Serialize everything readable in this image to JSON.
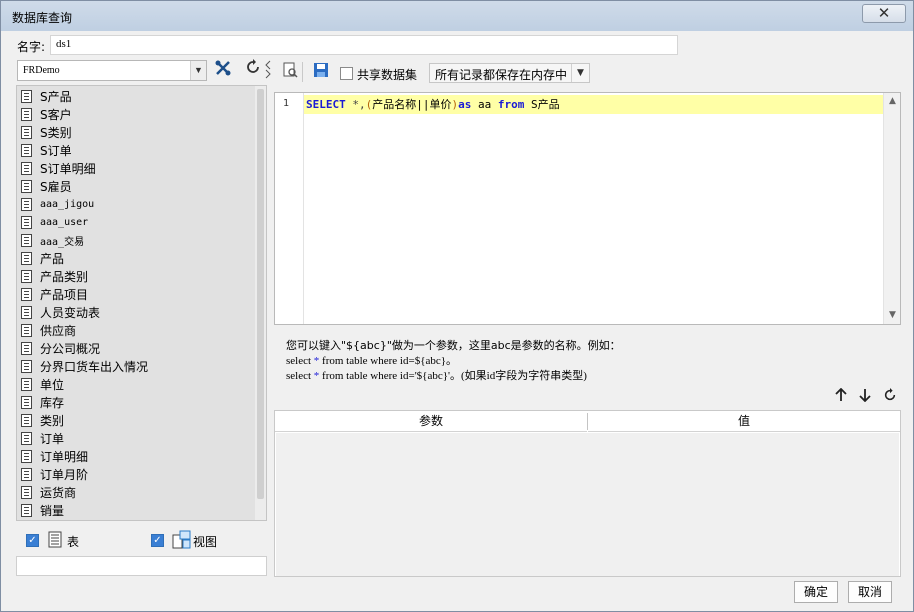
{
  "window": {
    "title": "数据库查询",
    "close_glyph": "✕"
  },
  "name_field": {
    "label": "名字:",
    "value": "ds1"
  },
  "datasource": {
    "selected": "FRDemo"
  },
  "tree": {
    "items": [
      {
        "label": "S产品",
        "mono": false
      },
      {
        "label": "S客户",
        "mono": false
      },
      {
        "label": "S类别",
        "mono": false
      },
      {
        "label": "S订单",
        "mono": false
      },
      {
        "label": "S订单明细",
        "mono": false
      },
      {
        "label": "S雇员",
        "mono": false
      },
      {
        "label": "aaa_jigou",
        "mono": true
      },
      {
        "label": "aaa_user",
        "mono": true
      },
      {
        "label": "aaa_交易",
        "mono": true
      },
      {
        "label": "产品",
        "mono": false
      },
      {
        "label": "产品类别",
        "mono": false
      },
      {
        "label": "产品项目",
        "mono": false
      },
      {
        "label": "人员变动表",
        "mono": false
      },
      {
        "label": "供应商",
        "mono": false
      },
      {
        "label": "分公司概况",
        "mono": false
      },
      {
        "label": "分界口货车出入情况",
        "mono": false
      },
      {
        "label": "单位",
        "mono": false
      },
      {
        "label": "库存",
        "mono": false
      },
      {
        "label": "类别",
        "mono": false
      },
      {
        "label": "订单",
        "mono": false
      },
      {
        "label": "订单明细",
        "mono": false
      },
      {
        "label": "订单月阶",
        "mono": false
      },
      {
        "label": "运货商",
        "mono": false
      },
      {
        "label": "销量",
        "mono": false
      }
    ]
  },
  "filters": {
    "table_label": "表",
    "view_label": "视图",
    "table_checked": true,
    "view_checked": true
  },
  "toolbar": {
    "share_label": "共享数据集",
    "memory_option": "所有记录都保存在内存中"
  },
  "editor": {
    "line_number": "1",
    "tokens": {
      "select": "SELECT",
      "star_comma": " *,",
      "lparen": "(",
      "col1": "产品名称||单价",
      "rparen": ")",
      "as": "as",
      "alias": " aa ",
      "from": "from",
      "table": " S产品"
    }
  },
  "hint": {
    "line1": "您可以键入\"${abc}\"做为一个参数，这里abc是参数的名称。例如：",
    "line2_a": "select ",
    "line2_star": "*",
    "line2_b": " from table where id=${abc}。",
    "line3_a": "select ",
    "line3_star": "*",
    "line3_b": " from table where id='${abc}'。(如果id字段为字符串类型)"
  },
  "params": {
    "col_param": "参数",
    "col_value": "值"
  },
  "buttons": {
    "ok": "确定",
    "cancel": "取消"
  },
  "colors": {
    "keyword": "#1a1ad6",
    "highlight_line": "#ffffa6",
    "paren": "#b6650a"
  }
}
